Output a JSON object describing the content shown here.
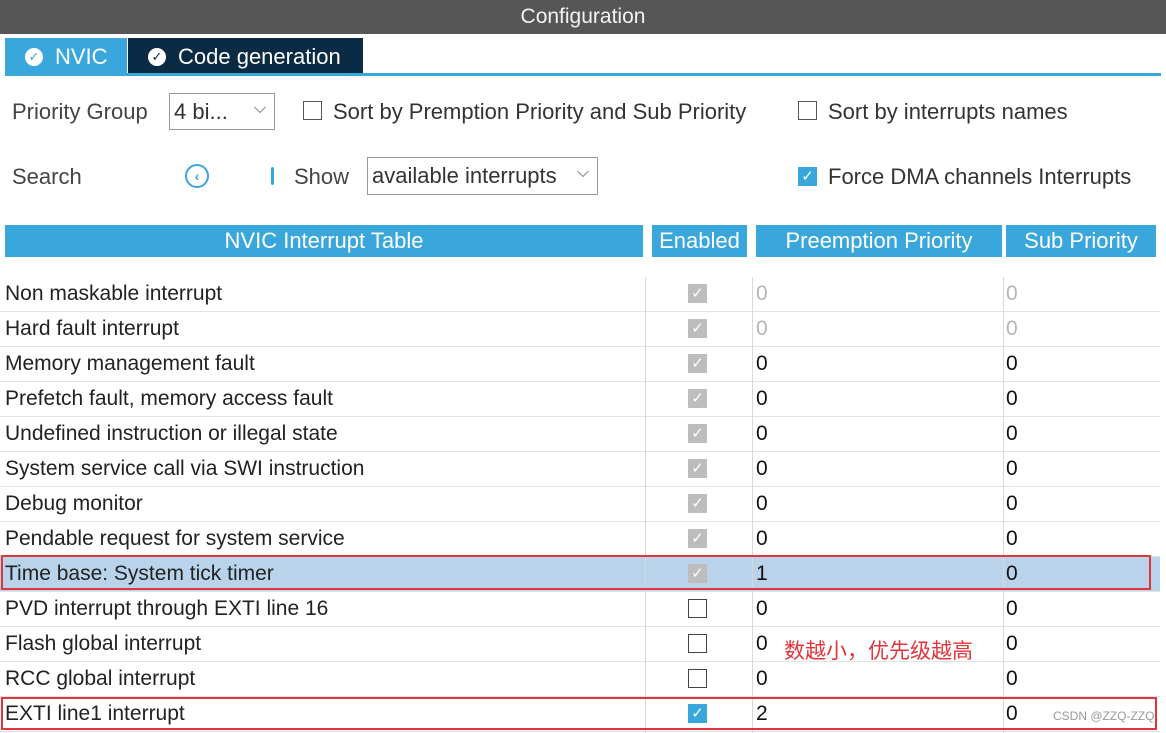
{
  "window": {
    "title": "Configuration"
  },
  "tabs": [
    {
      "label": "NVIC",
      "icon": "check-circle-icon",
      "active": true
    },
    {
      "label": "Code generation",
      "icon": "check-circle-icon",
      "active": false
    }
  ],
  "toolbar": {
    "priority_group_label": "Priority Group",
    "priority_group_value": "4 bi...",
    "sort_priority_label": "Sort by Premption Priority and Sub Priority",
    "sort_priority_checked": false,
    "sort_names_label": "Sort by interrupts names",
    "sort_names_checked": false,
    "search_label": "Search",
    "show_label": "Show",
    "show_value": "available interrupts",
    "force_dma_label": "Force DMA channels Interrupts",
    "force_dma_checked": true
  },
  "table": {
    "headers": [
      "NVIC Interrupt Table",
      "Enabled",
      "Preemption Priority",
      "Sub Priority"
    ],
    "rows": [
      {
        "name": "Non maskable interrupt",
        "enabled": "locked",
        "preemption": "0",
        "sub": "0",
        "dim": true
      },
      {
        "name": "Hard fault interrupt",
        "enabled": "locked",
        "preemption": "0",
        "sub": "0",
        "dim": true
      },
      {
        "name": "Memory management fault",
        "enabled": "locked",
        "preemption": "0",
        "sub": "0"
      },
      {
        "name": "Prefetch fault, memory access fault",
        "enabled": "locked",
        "preemption": "0",
        "sub": "0"
      },
      {
        "name": "Undefined instruction or illegal state",
        "enabled": "locked",
        "preemption": "0",
        "sub": "0"
      },
      {
        "name": "System service call via SWI instruction",
        "enabled": "locked",
        "preemption": "0",
        "sub": "0"
      },
      {
        "name": "Debug monitor",
        "enabled": "locked",
        "preemption": "0",
        "sub": "0"
      },
      {
        "name": "Pendable request for system service",
        "enabled": "locked",
        "preemption": "0",
        "sub": "0"
      },
      {
        "name": "Time base: System tick timer",
        "enabled": "locked",
        "preemption": "1",
        "sub": "0",
        "selected": true
      },
      {
        "name": "PVD interrupt through EXTI line 16",
        "enabled": "off",
        "preemption": "0",
        "sub": "0"
      },
      {
        "name": "Flash global interrupt",
        "enabled": "off",
        "preemption": "0",
        "sub": "0"
      },
      {
        "name": "RCC global interrupt",
        "enabled": "off",
        "preemption": "0",
        "sub": "0"
      },
      {
        "name": "EXTI line1 interrupt",
        "enabled": "on",
        "preemption": "2",
        "sub": "0"
      }
    ]
  },
  "annotation": {
    "text": "数越小，优先级越高",
    "color": "#e0353b"
  },
  "watermark": "CSDN @ZZQ-ZZQ",
  "colors": {
    "accent": "#3aa7dc",
    "titlebar": "#565656",
    "dark_tab": "#0b2b45",
    "selected_row": "#b9d3ea",
    "highlight": "#e0353b"
  }
}
